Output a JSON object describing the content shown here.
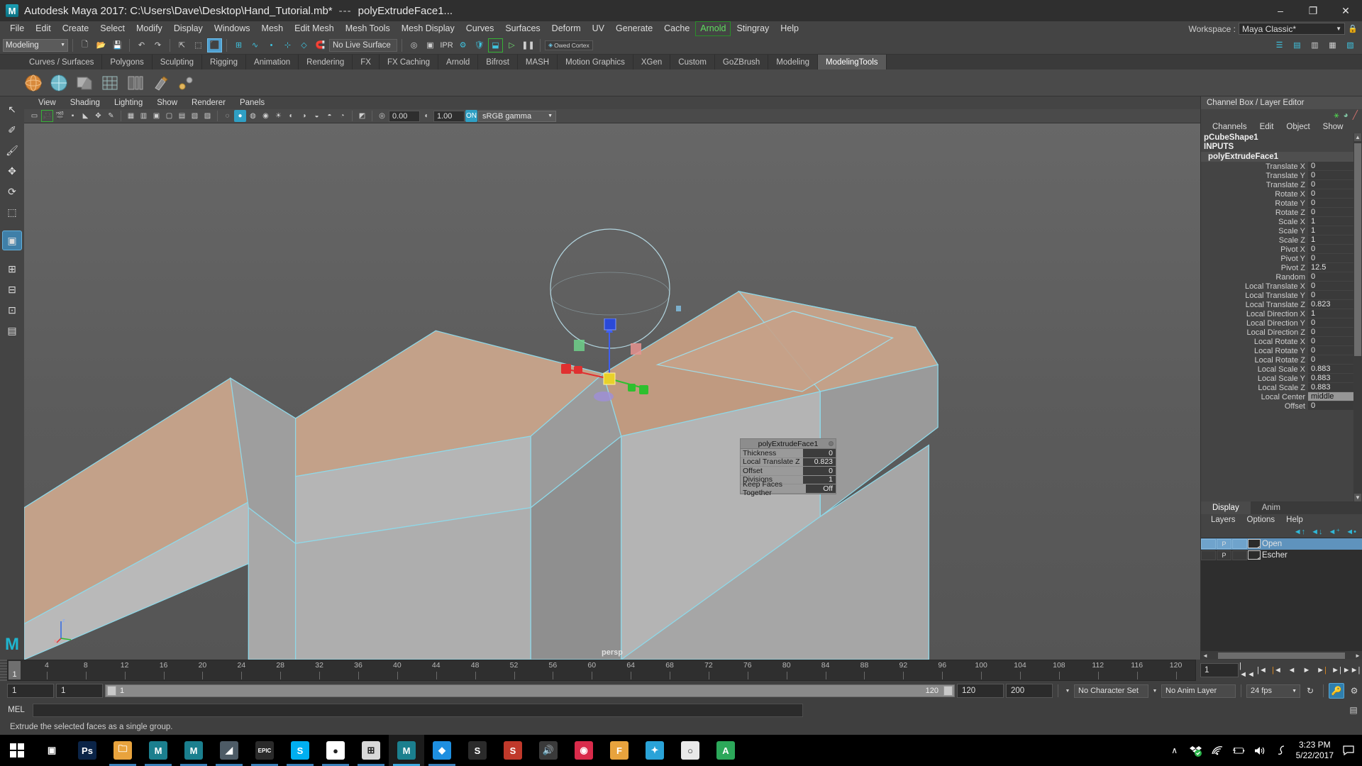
{
  "titlebar": {
    "app_title": "Autodesk Maya 2017: C:\\Users\\Dave\\Desktop\\Hand_Tutorial.mb*",
    "separator": "---",
    "node_title": "polyExtrudeFace1...",
    "minimize": "–",
    "maximize": "❐",
    "close": "✕"
  },
  "menubar": {
    "items": [
      {
        "label": "File",
        "accent": false
      },
      {
        "label": "Edit",
        "accent": false
      },
      {
        "label": "Create",
        "accent": false
      },
      {
        "label": "Select",
        "accent": false
      },
      {
        "label": "Modify",
        "accent": false
      },
      {
        "label": "Display",
        "accent": false
      },
      {
        "label": "Windows",
        "accent": false
      },
      {
        "label": "Mesh",
        "accent": false
      },
      {
        "label": "Edit Mesh",
        "accent": false
      },
      {
        "label": "Mesh Tools",
        "accent": false
      },
      {
        "label": "Mesh Display",
        "accent": false
      },
      {
        "label": "Curves",
        "accent": false
      },
      {
        "label": "Surfaces",
        "accent": false
      },
      {
        "label": "Deform",
        "accent": false
      },
      {
        "label": "UV",
        "accent": false
      },
      {
        "label": "Generate",
        "accent": false
      },
      {
        "label": "Cache",
        "accent": false
      },
      {
        "label": "Arnold",
        "accent": true
      },
      {
        "label": "Stingray",
        "accent": false
      },
      {
        "label": "Help",
        "accent": false
      }
    ],
    "workspace_label": "Workspace :",
    "workspace_value": "Maya Classic*",
    "accent_color": "#5fdc5f"
  },
  "statusline": {
    "mode_value": "Modeling",
    "no_live_surface": "No Live Surface",
    "cortex_tag": "Owed Cortex"
  },
  "shelf": {
    "tabs": [
      {
        "label": "Curves / Surfaces",
        "active": false
      },
      {
        "label": "Polygons",
        "active": false
      },
      {
        "label": "Sculpting",
        "active": false
      },
      {
        "label": "Rigging",
        "active": false
      },
      {
        "label": "Animation",
        "active": false
      },
      {
        "label": "Rendering",
        "active": false
      },
      {
        "label": "FX",
        "active": false
      },
      {
        "label": "FX Caching",
        "active": false
      },
      {
        "label": "Arnold",
        "active": false
      },
      {
        "label": "Bifrost",
        "active": false
      },
      {
        "label": "MASH",
        "active": false
      },
      {
        "label": "Motion Graphics",
        "active": false
      },
      {
        "label": "XGen",
        "active": false
      },
      {
        "label": "Custom",
        "active": false
      },
      {
        "label": "GoZBrush",
        "active": false
      },
      {
        "label": "Modeling",
        "active": false
      },
      {
        "label": "ModelingTools",
        "active": true
      }
    ]
  },
  "viewport": {
    "menus": [
      "View",
      "Shading",
      "Lighting",
      "Show",
      "Renderer",
      "Panels"
    ],
    "exposure_value": "0.00",
    "gamma_value": "1.00",
    "gamma_toggle": "ON",
    "color_profile": "sRGB gamma",
    "camera_label": "persp",
    "axis_x": "x",
    "axis_z": "z"
  },
  "tool_hud": {
    "title": "polyExtrudeFace1",
    "rows": [
      {
        "label": "Thickness",
        "value": "0"
      },
      {
        "label": "Local Translate Z",
        "value": "0.823"
      },
      {
        "label": "Offset",
        "value": "0"
      },
      {
        "label": "Divisions",
        "value": "1"
      },
      {
        "label": "Keep Faces Together",
        "value": "Off"
      }
    ]
  },
  "channelbox": {
    "panel_title": "Channel Box / Layer Editor",
    "menus": [
      "Channels",
      "Edit",
      "Object",
      "Show"
    ],
    "node_name": "pCubeShape1",
    "section_label": "INPUTS",
    "input_node": "polyExtrudeFace1",
    "attributes": [
      {
        "label": "Translate X",
        "value": "0",
        "alt": false
      },
      {
        "label": "Translate Y",
        "value": "0",
        "alt": false
      },
      {
        "label": "Translate Z",
        "value": "0",
        "alt": false
      },
      {
        "label": "Rotate X",
        "value": "0",
        "alt": false
      },
      {
        "label": "Rotate Y",
        "value": "0",
        "alt": false
      },
      {
        "label": "Rotate Z",
        "value": "0",
        "alt": false
      },
      {
        "label": "Scale X",
        "value": "1",
        "alt": false
      },
      {
        "label": "Scale Y",
        "value": "1",
        "alt": false
      },
      {
        "label": "Scale Z",
        "value": "1",
        "alt": false
      },
      {
        "label": "Pivot X",
        "value": "0",
        "alt": false
      },
      {
        "label": "Pivot Y",
        "value": "0",
        "alt": false
      },
      {
        "label": "Pivot Z",
        "value": "12.5",
        "alt": false
      },
      {
        "label": "Random",
        "value": "0",
        "alt": false
      },
      {
        "label": "Local Translate X",
        "value": "0",
        "alt": false
      },
      {
        "label": "Local Translate Y",
        "value": "0",
        "alt": false
      },
      {
        "label": "Local Translate Z",
        "value": "0.823",
        "alt": false
      },
      {
        "label": "Local Direction X",
        "value": "1",
        "alt": false
      },
      {
        "label": "Local Direction Y",
        "value": "0",
        "alt": false
      },
      {
        "label": "Local Direction Z",
        "value": "0",
        "alt": false
      },
      {
        "label": "Local Rotate X",
        "value": "0",
        "alt": false
      },
      {
        "label": "Local Rotate Y",
        "value": "0",
        "alt": false
      },
      {
        "label": "Local Rotate Z",
        "value": "0",
        "alt": false
      },
      {
        "label": "Local Scale X",
        "value": "0.883",
        "alt": false
      },
      {
        "label": "Local Scale Y",
        "value": "0.883",
        "alt": false
      },
      {
        "label": "Local Scale Z",
        "value": "0.883",
        "alt": false
      },
      {
        "label": "Local Center",
        "value": "middle",
        "alt": true
      },
      {
        "label": "Offset",
        "value": "0",
        "alt": false
      }
    ]
  },
  "layereditor": {
    "tabs": [
      {
        "label": "Display",
        "active": true
      },
      {
        "label": "Anim",
        "active": false
      }
    ],
    "menus": [
      "Layers",
      "Options",
      "Help"
    ],
    "layers": [
      {
        "name": "Open",
        "p_flag": "P",
        "selected": true
      },
      {
        "name": "Escher",
        "p_flag": "P",
        "selected": false
      }
    ]
  },
  "timeline": {
    "current_frame_marker": "1",
    "ticks": [
      4,
      8,
      12,
      16,
      20,
      24,
      28,
      32,
      36,
      40,
      44,
      48,
      52,
      56,
      60,
      64,
      68,
      72,
      76,
      80,
      84,
      88,
      92,
      96,
      100,
      104,
      108,
      112,
      116,
      120
    ],
    "current_frame_field": "1",
    "playback_buttons": [
      "go-to-start",
      "step-back-key",
      "step-back-frame",
      "play-backwards",
      "play-forwards",
      "step-forward-frame",
      "step-forward-key",
      "go-to-end"
    ]
  },
  "rangeslider": {
    "start_field": "1",
    "end_field": "1",
    "range_start_label": "1",
    "range_end_label": "120",
    "anim_start": "120",
    "anim_end": "200",
    "character_set": "No Character Set",
    "anim_layer": "No Anim Layer",
    "fps": "24 fps"
  },
  "commandline": {
    "language_label": "MEL",
    "input_value": ""
  },
  "helpline": {
    "message": "Extrude the selected faces as a single group."
  },
  "taskbar": {
    "apps": [
      {
        "name": "task-view",
        "glyph": "▣",
        "color": "#000000"
      },
      {
        "name": "photoshop",
        "glyph": "Ps",
        "color": "#0b2447"
      },
      {
        "name": "file-explorer",
        "glyph": "🗀",
        "color": "#e8a33d"
      },
      {
        "name": "maya-a",
        "glyph": "M",
        "color": "#1b7f8e"
      },
      {
        "name": "maya-b",
        "glyph": "M",
        "color": "#1b7f8e"
      },
      {
        "name": "zbrush",
        "glyph": "◢",
        "color": "#4d5b66"
      },
      {
        "name": "epic-games",
        "glyph": "EPIC",
        "color": "#2a2a2a"
      },
      {
        "name": "skype",
        "glyph": "S",
        "color": "#00aff0"
      },
      {
        "name": "chrome",
        "glyph": "●",
        "color": "#ffffff"
      },
      {
        "name": "calculator",
        "glyph": "⊞",
        "color": "#d8d8d8"
      },
      {
        "name": "maya-active",
        "glyph": "M",
        "color": "#1b7f8e"
      },
      {
        "name": "dropbox",
        "glyph": "◆",
        "color": "#1e8fe0"
      },
      {
        "name": "substance",
        "glyph": "S",
        "color": "#2b2b2b"
      },
      {
        "name": "substance-painter",
        "glyph": "S",
        "color": "#c0392b"
      },
      {
        "name": "audio-app",
        "glyph": "🔊",
        "color": "#3a3a3a"
      },
      {
        "name": "keyshot",
        "glyph": "◉",
        "color": "#d92b4b"
      },
      {
        "name": "fontlab",
        "glyph": "F",
        "color": "#e8a33d"
      },
      {
        "name": "mixamo",
        "glyph": "✦",
        "color": "#2aa3d8"
      },
      {
        "name": "oculus",
        "glyph": "○",
        "color": "#e8e8e8"
      },
      {
        "name": "autodesk",
        "glyph": "A",
        "color": "#2ca85a"
      }
    ],
    "tray": {
      "chevron": "∧",
      "dropbox": "dropbox-icon",
      "wifi": "wifi-icon",
      "battery": "battery-charging-icon",
      "volume": "volume-icon",
      "pen": "pen-icon",
      "time": "3:23 PM",
      "date": "5/22/2017",
      "action_center": "action-center-icon"
    }
  }
}
